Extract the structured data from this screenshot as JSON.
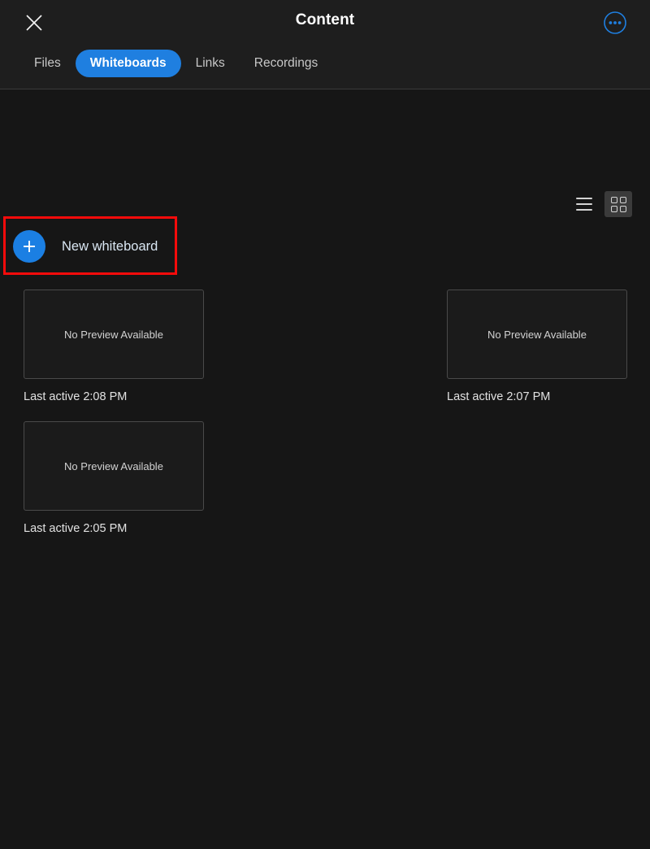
{
  "header": {
    "title": "Content",
    "close_icon": "close-x-icon",
    "more_icon": "more-options-icon",
    "tabs": [
      {
        "label": "Files",
        "active": false
      },
      {
        "label": "Whiteboards",
        "active": true
      },
      {
        "label": "Links",
        "active": false
      },
      {
        "label": "Recordings",
        "active": false
      }
    ]
  },
  "toolbar": {
    "list_view_icon": "list-view-icon",
    "grid_view_icon": "grid-view-icon",
    "selected_view": "grid"
  },
  "new_whiteboard": {
    "label": "New whiteboard",
    "plus_icon": "plus-icon",
    "highlight_color": "#f60b0b",
    "button_color": "#1b7fe3"
  },
  "whiteboards": [
    {
      "preview_text": "No Preview Available",
      "meta": "Last active 2:08 PM"
    },
    {
      "preview_text": "No Preview Available",
      "meta": "Last active 2:07 PM"
    },
    {
      "preview_text": "No Preview Available",
      "meta": "Last active 2:05 PM"
    }
  ],
  "colors": {
    "accent": "#1f7fe0",
    "highlight": "#f60b0b",
    "header_bg": "#1e1e1e",
    "content_bg": "#161616"
  }
}
